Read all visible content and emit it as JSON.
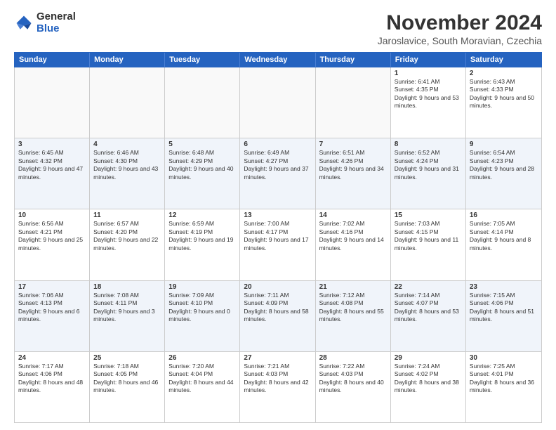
{
  "logo": {
    "general": "General",
    "blue": "Blue"
  },
  "title": "November 2024",
  "location": "Jaroslavice, South Moravian, Czechia",
  "header": {
    "days": [
      "Sunday",
      "Monday",
      "Tuesday",
      "Wednesday",
      "Thursday",
      "Friday",
      "Saturday"
    ]
  },
  "rows": [
    {
      "alt": false,
      "cells": [
        {
          "empty": true,
          "day": "",
          "text": ""
        },
        {
          "empty": true,
          "day": "",
          "text": ""
        },
        {
          "empty": true,
          "day": "",
          "text": ""
        },
        {
          "empty": true,
          "day": "",
          "text": ""
        },
        {
          "empty": true,
          "day": "",
          "text": ""
        },
        {
          "empty": false,
          "day": "1",
          "text": "Sunrise: 6:41 AM\nSunset: 4:35 PM\nDaylight: 9 hours and 53 minutes."
        },
        {
          "empty": false,
          "day": "2",
          "text": "Sunrise: 6:43 AM\nSunset: 4:33 PM\nDaylight: 9 hours and 50 minutes."
        }
      ]
    },
    {
      "alt": true,
      "cells": [
        {
          "empty": false,
          "day": "3",
          "text": "Sunrise: 6:45 AM\nSunset: 4:32 PM\nDaylight: 9 hours and 47 minutes."
        },
        {
          "empty": false,
          "day": "4",
          "text": "Sunrise: 6:46 AM\nSunset: 4:30 PM\nDaylight: 9 hours and 43 minutes."
        },
        {
          "empty": false,
          "day": "5",
          "text": "Sunrise: 6:48 AM\nSunset: 4:29 PM\nDaylight: 9 hours and 40 minutes."
        },
        {
          "empty": false,
          "day": "6",
          "text": "Sunrise: 6:49 AM\nSunset: 4:27 PM\nDaylight: 9 hours and 37 minutes."
        },
        {
          "empty": false,
          "day": "7",
          "text": "Sunrise: 6:51 AM\nSunset: 4:26 PM\nDaylight: 9 hours and 34 minutes."
        },
        {
          "empty": false,
          "day": "8",
          "text": "Sunrise: 6:52 AM\nSunset: 4:24 PM\nDaylight: 9 hours and 31 minutes."
        },
        {
          "empty": false,
          "day": "9",
          "text": "Sunrise: 6:54 AM\nSunset: 4:23 PM\nDaylight: 9 hours and 28 minutes."
        }
      ]
    },
    {
      "alt": false,
      "cells": [
        {
          "empty": false,
          "day": "10",
          "text": "Sunrise: 6:56 AM\nSunset: 4:21 PM\nDaylight: 9 hours and 25 minutes."
        },
        {
          "empty": false,
          "day": "11",
          "text": "Sunrise: 6:57 AM\nSunset: 4:20 PM\nDaylight: 9 hours and 22 minutes."
        },
        {
          "empty": false,
          "day": "12",
          "text": "Sunrise: 6:59 AM\nSunset: 4:19 PM\nDaylight: 9 hours and 19 minutes."
        },
        {
          "empty": false,
          "day": "13",
          "text": "Sunrise: 7:00 AM\nSunset: 4:17 PM\nDaylight: 9 hours and 17 minutes."
        },
        {
          "empty": false,
          "day": "14",
          "text": "Sunrise: 7:02 AM\nSunset: 4:16 PM\nDaylight: 9 hours and 14 minutes."
        },
        {
          "empty": false,
          "day": "15",
          "text": "Sunrise: 7:03 AM\nSunset: 4:15 PM\nDaylight: 9 hours and 11 minutes."
        },
        {
          "empty": false,
          "day": "16",
          "text": "Sunrise: 7:05 AM\nSunset: 4:14 PM\nDaylight: 9 hours and 8 minutes."
        }
      ]
    },
    {
      "alt": true,
      "cells": [
        {
          "empty": false,
          "day": "17",
          "text": "Sunrise: 7:06 AM\nSunset: 4:13 PM\nDaylight: 9 hours and 6 minutes."
        },
        {
          "empty": false,
          "day": "18",
          "text": "Sunrise: 7:08 AM\nSunset: 4:11 PM\nDaylight: 9 hours and 3 minutes."
        },
        {
          "empty": false,
          "day": "19",
          "text": "Sunrise: 7:09 AM\nSunset: 4:10 PM\nDaylight: 9 hours and 0 minutes."
        },
        {
          "empty": false,
          "day": "20",
          "text": "Sunrise: 7:11 AM\nSunset: 4:09 PM\nDaylight: 8 hours and 58 minutes."
        },
        {
          "empty": false,
          "day": "21",
          "text": "Sunrise: 7:12 AM\nSunset: 4:08 PM\nDaylight: 8 hours and 55 minutes."
        },
        {
          "empty": false,
          "day": "22",
          "text": "Sunrise: 7:14 AM\nSunset: 4:07 PM\nDaylight: 8 hours and 53 minutes."
        },
        {
          "empty": false,
          "day": "23",
          "text": "Sunrise: 7:15 AM\nSunset: 4:06 PM\nDaylight: 8 hours and 51 minutes."
        }
      ]
    },
    {
      "alt": false,
      "cells": [
        {
          "empty": false,
          "day": "24",
          "text": "Sunrise: 7:17 AM\nSunset: 4:06 PM\nDaylight: 8 hours and 48 minutes."
        },
        {
          "empty": false,
          "day": "25",
          "text": "Sunrise: 7:18 AM\nSunset: 4:05 PM\nDaylight: 8 hours and 46 minutes."
        },
        {
          "empty": false,
          "day": "26",
          "text": "Sunrise: 7:20 AM\nSunset: 4:04 PM\nDaylight: 8 hours and 44 minutes."
        },
        {
          "empty": false,
          "day": "27",
          "text": "Sunrise: 7:21 AM\nSunset: 4:03 PM\nDaylight: 8 hours and 42 minutes."
        },
        {
          "empty": false,
          "day": "28",
          "text": "Sunrise: 7:22 AM\nSunset: 4:03 PM\nDaylight: 8 hours and 40 minutes."
        },
        {
          "empty": false,
          "day": "29",
          "text": "Sunrise: 7:24 AM\nSunset: 4:02 PM\nDaylight: 8 hours and 38 minutes."
        },
        {
          "empty": false,
          "day": "30",
          "text": "Sunrise: 7:25 AM\nSunset: 4:01 PM\nDaylight: 8 hours and 36 minutes."
        }
      ]
    }
  ]
}
